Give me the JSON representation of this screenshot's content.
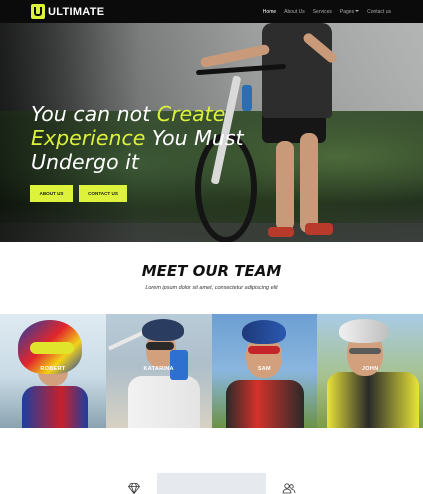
{
  "brand": {
    "name": "ULTIMATE",
    "logo_color": "#dcf23b"
  },
  "nav": {
    "items": [
      {
        "label": "Home",
        "active": true
      },
      {
        "label": "About Us",
        "active": false
      },
      {
        "label": "Services",
        "active": false
      },
      {
        "label": "Pages",
        "active": false,
        "has_dropdown": true
      },
      {
        "label": "Contact us",
        "active": false
      }
    ]
  },
  "hero": {
    "title_line1_white": "You can not ",
    "title_line1_highlight": "Create",
    "title_line2_highlight": "Experience",
    "title_line2_white": " You Must",
    "title_line3": "Undergo it",
    "buttons": [
      {
        "label": "ABOUT US"
      },
      {
        "label": "CONTACT US"
      }
    ],
    "accent": "#dcf23b"
  },
  "team": {
    "title": "MEET OUR TEAM",
    "subtitle": "Lorem ipsum dolor sit amet, consectetur adipiscing elit",
    "members": [
      {
        "name": "ROBERT"
      },
      {
        "name": "KATARINA"
      },
      {
        "name": "SAM"
      },
      {
        "name": "JOHN"
      }
    ]
  },
  "features": {
    "icons": [
      "diamond-icon",
      "users-icon"
    ]
  }
}
